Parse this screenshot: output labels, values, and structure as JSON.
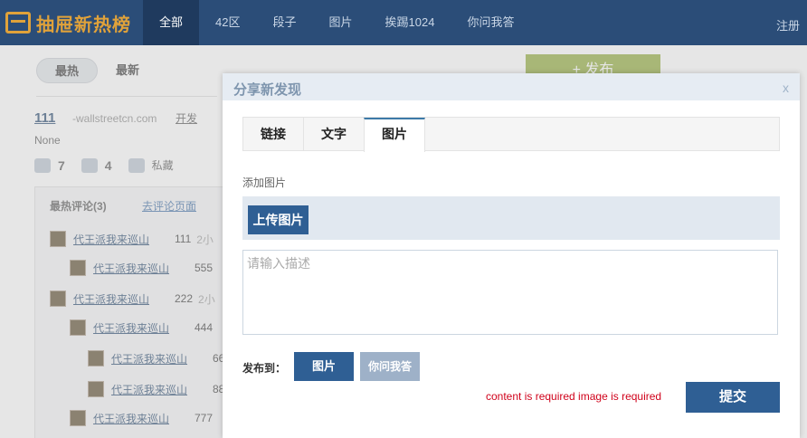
{
  "header": {
    "logo_text": "抽屉新热榜",
    "nav": [
      "全部",
      "42区",
      "段子",
      "图片",
      "挨踢1024",
      "你问我答"
    ],
    "login": "注册"
  },
  "page": {
    "sort_tabs": [
      "最热",
      "最新"
    ],
    "publish_button": "+ 发布",
    "post": {
      "title": "111",
      "domain": "-wallstreetcn.com",
      "user": "开发",
      "description": "None",
      "likes": "7",
      "comments": "4",
      "private": "私藏"
    },
    "comments": {
      "header": "最热评论(3)",
      "link": "去评论页面",
      "rows": [
        {
          "name": "代王派我来巡山",
          "score": "111",
          "time": "2小"
        },
        {
          "name": "代王派我来巡山",
          "score": "555",
          "time": ""
        },
        {
          "name": "代王派我来巡山",
          "score": "222",
          "time": "2小"
        },
        {
          "name": "代王派我来巡山",
          "score": "444",
          "time": ""
        },
        {
          "name": "代王派我来巡山",
          "score": "66",
          "time": ""
        },
        {
          "name": "代王派我来巡山",
          "score": "88",
          "time": ""
        },
        {
          "name": "代王派我来巡山",
          "score": "777",
          "time": ""
        }
      ]
    }
  },
  "modal": {
    "title": "分享新发现",
    "close": "x",
    "tabs": [
      "链接",
      "文字",
      "图片"
    ],
    "active_tab": "图片",
    "add_image_label": "添加图片",
    "upload_button": "上传图片",
    "description_placeholder": "请输入描述",
    "description_value": "",
    "publish_to_label": "发布到：",
    "channel_selected": "图片",
    "channel_other": "你问我答",
    "errors": "content is required  image is required",
    "submit": "提交"
  }
}
